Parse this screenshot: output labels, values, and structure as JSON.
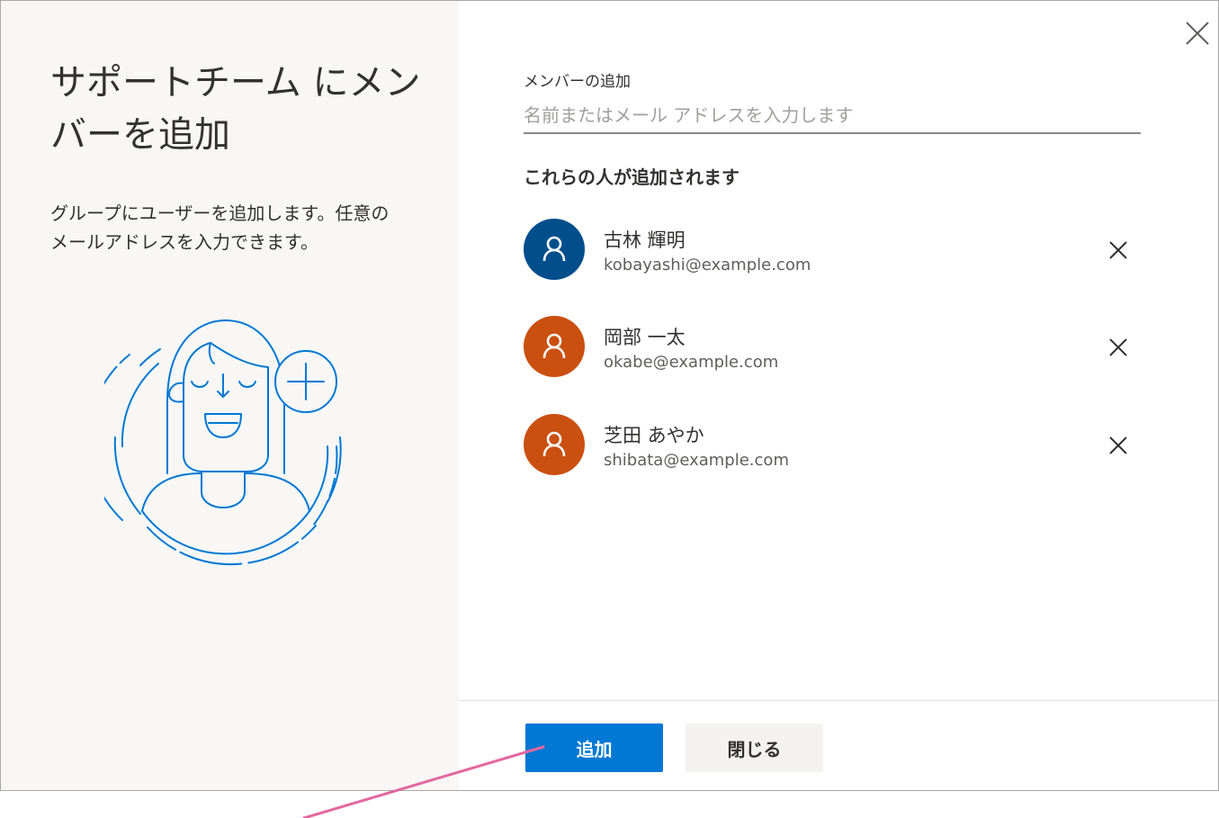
{
  "dialog": {
    "title": "サポートチーム にメンバーを追加",
    "description": "グループにユーザーを追加します。任意のメールアドレスを入力できます。"
  },
  "add_member": {
    "label": "メンバーの追加",
    "placeholder": "名前またはメール アドレスを入力します",
    "value": ""
  },
  "members_section": {
    "heading": "これらの人が追加されます",
    "members": [
      {
        "name": "古林 輝明",
        "email": "kobayashi@example.com",
        "avatar_color": "#004e8c"
      },
      {
        "name": "岡部 一太",
        "email": "okabe@example.com",
        "avatar_color": "#ca5010"
      },
      {
        "name": "芝田 あやか",
        "email": "shibata@example.com",
        "avatar_color": "#ca5010"
      }
    ]
  },
  "footer": {
    "add_label": "追加",
    "close_label": "閉じる"
  },
  "colors": {
    "accent": "#0078d4",
    "annotation": "#e3679f",
    "illustration": "#0078d4"
  },
  "icons": {
    "close": "close-icon",
    "remove": "remove-icon",
    "person": "person-icon"
  }
}
